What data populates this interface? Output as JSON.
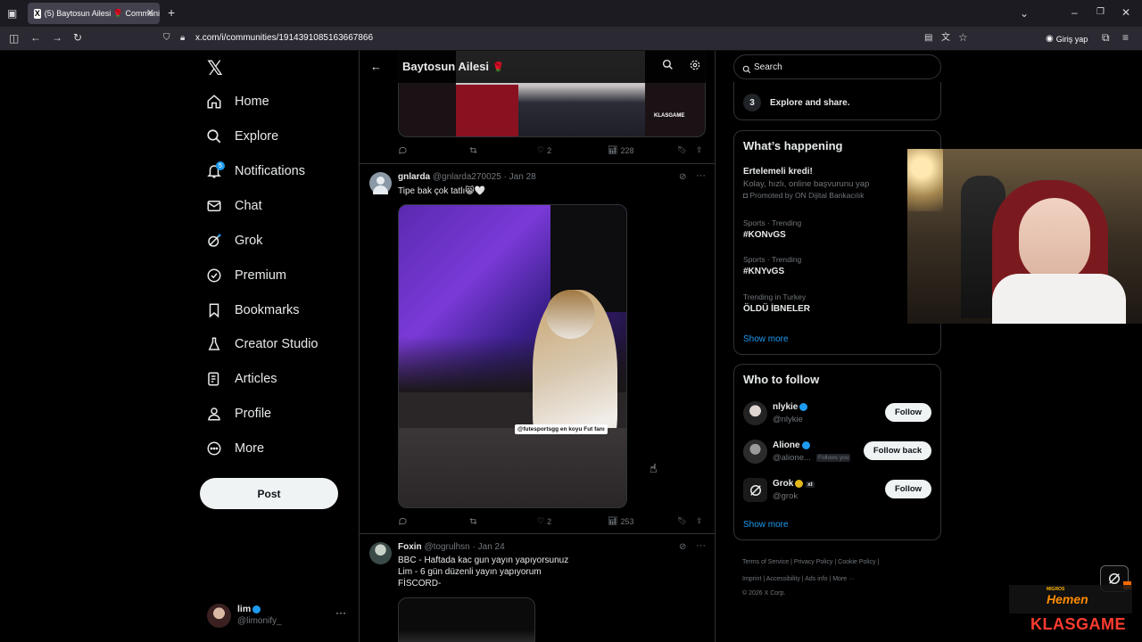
{
  "browser": {
    "tab_title": "(5) Baytosun Ailesi 🌹 Communi",
    "url": "x.com/i/communities/1914391085163667866",
    "login_label": "Giriş yap"
  },
  "sidebar": {
    "items": [
      {
        "label": "Home",
        "icon": "home-icon"
      },
      {
        "label": "Explore",
        "icon": "search-icon"
      },
      {
        "label": "Notifications",
        "icon": "bell-icon",
        "badge": "5"
      },
      {
        "label": "Chat",
        "icon": "mail-icon"
      },
      {
        "label": "Grok",
        "icon": "grok-icon"
      },
      {
        "label": "Premium",
        "icon": "premium-icon"
      },
      {
        "label": "Bookmarks",
        "icon": "bookmark-icon"
      },
      {
        "label": "Creator Studio",
        "icon": "flask-icon"
      },
      {
        "label": "Articles",
        "icon": "article-icon"
      },
      {
        "label": "Profile",
        "icon": "person-icon"
      },
      {
        "label": "More",
        "icon": "more-circle-icon"
      }
    ],
    "post_label": "Post",
    "account": {
      "name": "lim",
      "handle": "@limonify_"
    }
  },
  "header": {
    "title": "Baytosun Ailesi",
    "emoji": "🌹"
  },
  "tweets": [
    {
      "stats": {
        "replies": "",
        "reposts": "",
        "likes": "2",
        "views": "228"
      }
    },
    {
      "name": "gnlarda",
      "handle": "@gnlarda270025",
      "date": "· Jan 28",
      "text": "Tipe bak çok tatlı😸🤍",
      "media_caption": "@futesportsgg en koyu Fut fanı",
      "stats": {
        "replies": "",
        "reposts": "",
        "likes": "2",
        "views": "253"
      }
    },
    {
      "name": "Foxin",
      "handle": "@togrulhsn",
      "date": "· Jan 24",
      "lines": [
        "BBC - Haftada kac gun yayın yapıyorsunuz",
        "Lim - 6 gün düzenli yayın yapıyorum",
        "FİSCORD-"
      ]
    }
  ],
  "right": {
    "search_placeholder": "Search",
    "explore_step": {
      "number": "3",
      "label": "Explore and share."
    },
    "happening": {
      "title": "What’s happening",
      "promo_title": "Ertelemeli kredi!",
      "promo_sub": "Kolay, hızlı, online başvurunu yap",
      "promo_by": "Promoted by ON Dijital Bankacılık",
      "trends": [
        {
          "context": "Sports · Trending",
          "name": "#KONvGS"
        },
        {
          "context": "Sports · Trending",
          "name": "#KNYvGS"
        },
        {
          "context": "Trending in Turkey",
          "name": "ÖLDÜ İBNELER"
        }
      ],
      "show_more": "Show more"
    },
    "who_to_follow": {
      "title": "Who to follow",
      "users": [
        {
          "name": "nlykie",
          "handle": "@nlykie",
          "button": "Follow",
          "follows_you": ""
        },
        {
          "name": "Alione",
          "handle": "@alione...",
          "button": "Follow back",
          "follows_you": "Follows you"
        },
        {
          "name": "Grok",
          "handle": "@grok",
          "button": "Follow",
          "follows_you": "",
          "tag": "xI"
        }
      ],
      "show_more": "Show more"
    },
    "footer": {
      "row1": [
        "Terms of Service",
        "Privacy Policy",
        "Cookie Policy"
      ],
      "row2": [
        "Imprint",
        "Accessibility",
        "Ads info",
        "More ···"
      ],
      "copyright": "© 2026 X Corp."
    }
  },
  "overlay": {
    "brand_small": "MIGROS",
    "brand_big": "Hemen",
    "sponsor": "KLASGAME"
  },
  "colors": {
    "accent": "#1d9bf0",
    "background": "#000000",
    "border": "#2f3336",
    "muted": "#71767b"
  }
}
